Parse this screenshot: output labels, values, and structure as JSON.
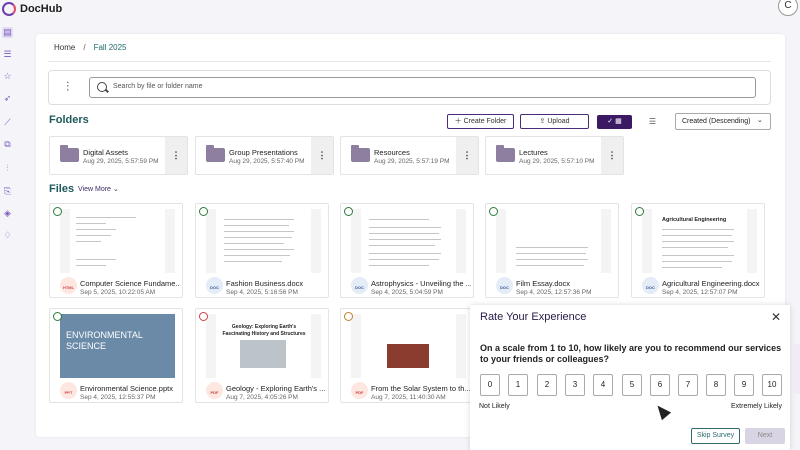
{
  "app": {
    "brand": "DocHub",
    "avatar_initial": "C"
  },
  "breadcrumb": {
    "home": "Home",
    "separator": "/",
    "current": "Fall 2025"
  },
  "search": {
    "placeholder": "Search by file or folder name"
  },
  "folders_section": {
    "title": "Folders",
    "create_label": "Create Folder",
    "upload_label": "Upload",
    "sort_label": "Created (Descending)",
    "items": [
      {
        "name": "Digital Assets",
        "date": "Aug 29, 2025, 5:57:59 PM"
      },
      {
        "name": "Group Presentations",
        "date": "Aug 29, 2025, 5:57:40 PM"
      },
      {
        "name": "Resources",
        "date": "Aug 29, 2025, 5:57:19 PM"
      },
      {
        "name": "Lectures",
        "date": "Aug 29, 2025, 5:57:10 PM"
      }
    ]
  },
  "files_section": {
    "title": "Files",
    "view_more": "View More",
    "items": [
      {
        "name": "Computer Science Fundame...",
        "date": "Sep 5, 2025, 10:22:05 AM",
        "type": "HTML"
      },
      {
        "name": "Fashion Business.docx",
        "date": "Sep 4, 2025, 5:16:56 PM",
        "type": "DOC"
      },
      {
        "name": "Astrophysics - Unveiling the ...",
        "date": "Sep 4, 2025, 5:04:59 PM",
        "type": "DOC"
      },
      {
        "name": "Film Essay.docx",
        "date": "Sep 4, 2025, 12:57:36 PM",
        "type": "DOC"
      },
      {
        "name": "Agricultural Engineering.docx",
        "date": "Sep 4, 2025, 12:57:07 PM",
        "type": "DOC"
      },
      {
        "name": "Environmental Science.pptx",
        "date": "Sep 4, 2025, 12:55:37 PM",
        "type": "PPT"
      },
      {
        "name": "Geology - Exploring Earth's ...",
        "date": "Aug 7, 2025, 4:05:26 PM",
        "type": "PDF"
      },
      {
        "name": "From the Solar System to th...",
        "date": "Aug 7, 2025, 11:40:30 AM",
        "type": "PDF"
      }
    ],
    "thumb_titles": {
      "agri": "Agricultural Engineering",
      "env": "ENVIRONMENTAL SCIENCE",
      "geo": "Geology: Exploring Earth's Fascinating History and Structures"
    }
  },
  "survey": {
    "title": "Rate Your Experience",
    "question": "On a scale from 1 to 10, how likely are you to recommend our services to your friends or colleagues?",
    "scale": [
      "0",
      "1",
      "2",
      "3",
      "4",
      "5",
      "6",
      "7",
      "8",
      "9",
      "10"
    ],
    "low_label": "Not Likely",
    "high_label": "Extremely Likely",
    "skip_label": "Skip Survey",
    "next_label": "Next"
  },
  "colors": {
    "accent": "#3b1a63",
    "teal": "#1e5a5a",
    "brand_purple": "#6a3fb0"
  }
}
